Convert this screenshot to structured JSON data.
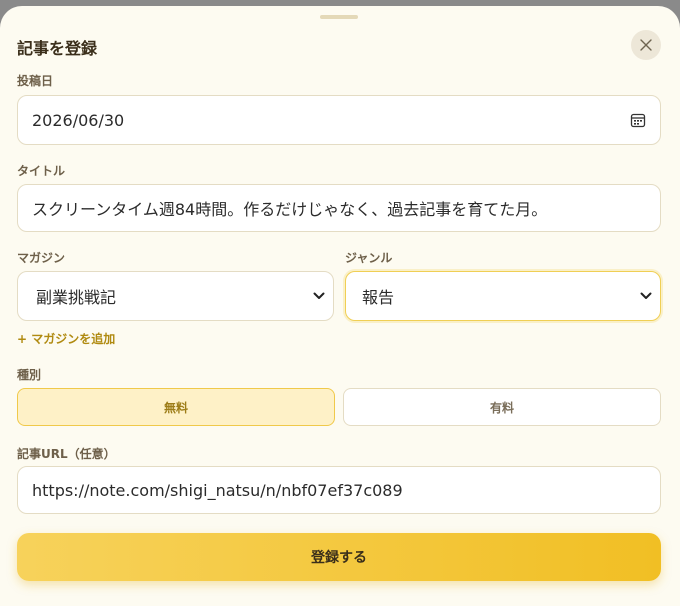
{
  "dialog": {
    "title": "記事を登録"
  },
  "form": {
    "date": {
      "label": "投稿日",
      "value": "2026/06/30"
    },
    "title_field": {
      "label": "タイトル",
      "value": "スクリーンタイム週84時間。作るだけじゃなく、過去記事を育てた月。"
    },
    "magazine": {
      "label": "マガジン",
      "selected": "副業挑戦記"
    },
    "genre": {
      "label": "ジャンル",
      "selected": "報告"
    },
    "add_magazine": "+ マガジンを追加",
    "type": {
      "label": "種別",
      "options": [
        "無料",
        "有料"
      ],
      "active_index": 0
    },
    "url": {
      "label": "記事URL（任意）",
      "value": "https://note.com/shigi_natsu/n/nbf07ef37c089"
    },
    "submit_label": "登録する"
  },
  "colors": {
    "accent": "#f3c73c",
    "accent_dark": "#b08a10",
    "background": "#fdfbf1"
  },
  "icons": {
    "close": "close-icon",
    "calendar": "calendar-icon",
    "chevron": "chevron-down-icon"
  }
}
